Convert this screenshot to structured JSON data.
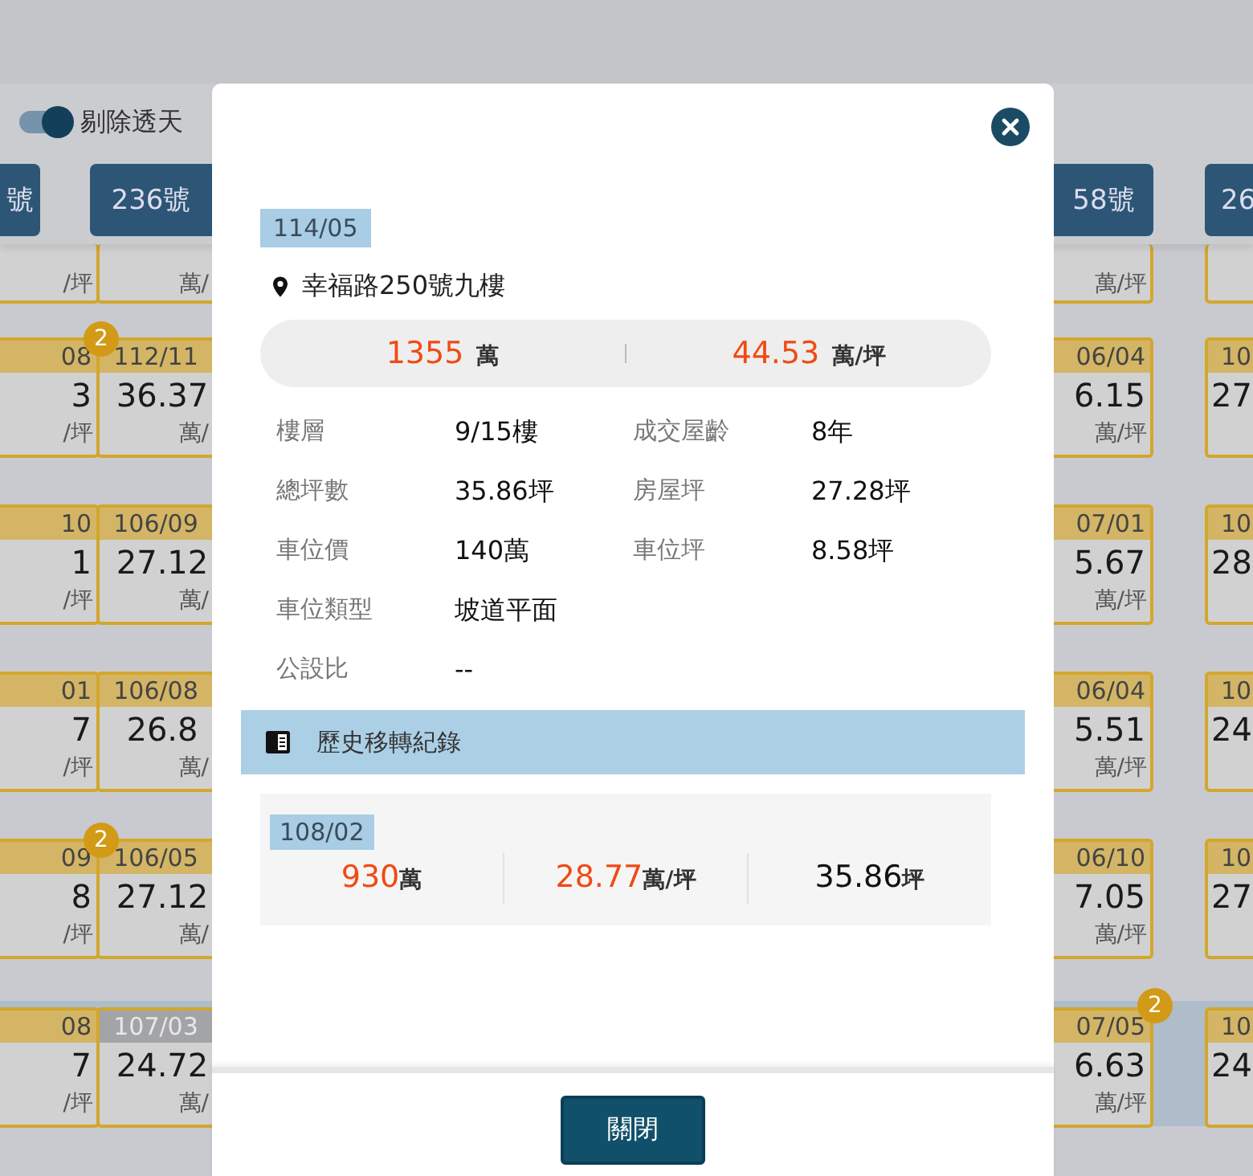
{
  "toolbar": {
    "toggle": {
      "on": true,
      "label": "剔除透天"
    }
  },
  "column_buttons": [
    "號",
    "236號",
    "58號",
    "26"
  ],
  "grid_rows": [
    {
      "highlighted": false,
      "partial": true,
      "cells": [
        {
          "unit": "/坪"
        },
        {
          "unit": "萬/"
        },
        {
          "unit": "萬/坪"
        },
        {}
      ]
    },
    {
      "highlighted": false,
      "partial": false,
      "cells": [
        {
          "date": "08",
          "value": "3",
          "unit": "/坪",
          "badge": "2",
          "dimmed": false
        },
        {
          "date": "112/11",
          "value": "36.37",
          "unit": "萬/",
          "dimmed": false
        },
        {
          "date": "06/04",
          "value": "6.15",
          "unit": "萬/坪",
          "dimmed": false
        },
        {
          "date": "10",
          "value": "27",
          "dimmed": false
        }
      ]
    },
    {
      "highlighted": false,
      "partial": false,
      "cells": [
        {
          "date": "10",
          "value": "1",
          "unit": "/坪",
          "dimmed": false
        },
        {
          "date": "106/09",
          "value": "27.12",
          "unit": "萬/",
          "dimmed": false
        },
        {
          "date": "07/01",
          "value": "5.67",
          "unit": "萬/坪",
          "dimmed": false
        },
        {
          "date": "10",
          "value": "28",
          "dimmed": false
        }
      ]
    },
    {
      "highlighted": false,
      "partial": false,
      "cells": [
        {
          "date": "01",
          "value": "7",
          "unit": "/坪",
          "dimmed": false
        },
        {
          "date": "106/08",
          "value": "26.8",
          "unit": "萬/",
          "dimmed": false
        },
        {
          "date": "06/04",
          "value": "5.51",
          "unit": "萬/坪",
          "dimmed": false
        },
        {
          "date": "10",
          "value": "24",
          "dimmed": false
        }
      ]
    },
    {
      "highlighted": false,
      "partial": false,
      "cells": [
        {
          "date": "09",
          "value": "8",
          "unit": "/坪",
          "badge": "2",
          "dimmed": false
        },
        {
          "date": "106/05",
          "value": "27.12",
          "unit": "萬/",
          "dimmed": false
        },
        {
          "date": "06/10",
          "value": "7.05",
          "unit": "萬/坪",
          "dimmed": false
        },
        {
          "date": "10",
          "value": "27",
          "dimmed": false
        }
      ]
    },
    {
      "highlighted": true,
      "partial": false,
      "cells": [
        {
          "date": "08",
          "value": "7",
          "unit": "/坪",
          "dimmed": false
        },
        {
          "date": "107/03",
          "value": "24.72",
          "unit": "萬/",
          "dimmed": true
        },
        {
          "date": "07/05",
          "value": "6.63",
          "unit": "萬/坪",
          "badge": "2",
          "dimmed": false
        },
        {
          "date": "10",
          "value": "24",
          "dimmed": false
        }
      ]
    }
  ],
  "modal": {
    "date": "114/05",
    "address": "幸福路250號九樓",
    "total_price": {
      "value": "1355",
      "unit": "萬"
    },
    "unit_price": {
      "value": "44.53",
      "unit": "萬/坪"
    },
    "details": [
      {
        "label": "樓層",
        "value": "9/15樓"
      },
      {
        "label": "成交屋齡",
        "value": "8年"
      },
      {
        "label": "總坪數",
        "value": "35.86坪"
      },
      {
        "label": "房屋坪",
        "value": "27.28坪"
      },
      {
        "label": "車位價",
        "value": "140萬"
      },
      {
        "label": "車位坪",
        "value": "8.58坪"
      },
      {
        "label": "車位類型",
        "value": "坡道平面"
      },
      {
        "label": "公設比",
        "value": "--"
      }
    ],
    "history_title": "歷史移轉紀錄",
    "history": [
      {
        "date": "108/02",
        "price": {
          "value": "930",
          "unit": "萬"
        },
        "unit_price": {
          "value": "28.77",
          "unit": "萬/坪"
        },
        "area": {
          "value": "35.86",
          "unit": "坪"
        }
      }
    ],
    "close_button": "關閉"
  }
}
